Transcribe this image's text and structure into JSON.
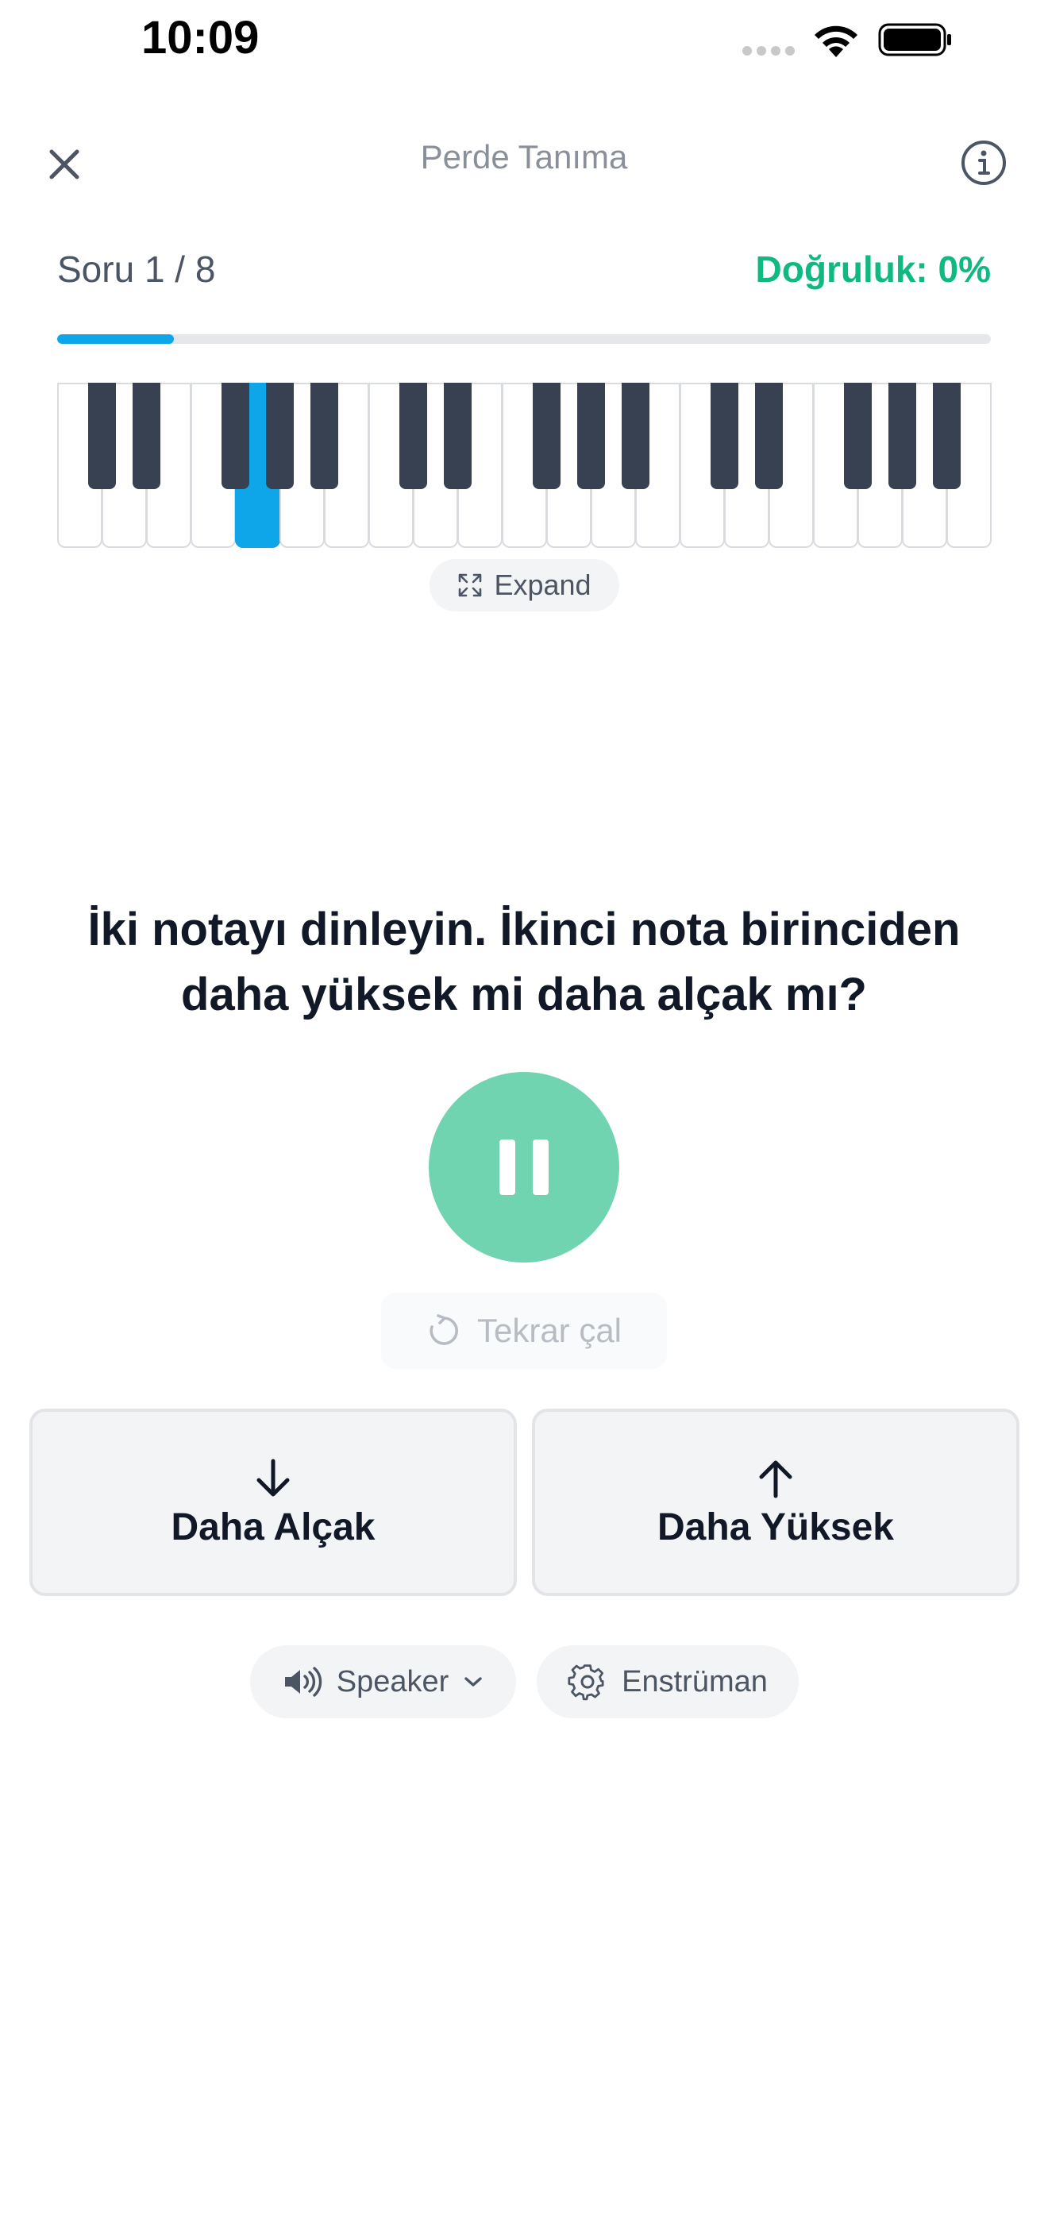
{
  "status_bar": {
    "time": "10:09"
  },
  "header": {
    "title": "Perde Tanıma"
  },
  "progress": {
    "counter": "Soru 1 / 8",
    "accuracy": "Doğruluk: 0%",
    "fraction": 0.125
  },
  "piano": {
    "white_key_count": 21,
    "active_key": "white-4"
  },
  "expand": {
    "label": "Expand"
  },
  "question": {
    "text": "İki notayı dinleyin. İkinci nota birinciden daha yüksek mi daha alçak mı?"
  },
  "replay": {
    "label": "Tekrar çal"
  },
  "answers": {
    "lower": "Daha Alçak",
    "higher": "Daha Yüksek"
  },
  "controls": {
    "output_label": "Speaker",
    "instrument_label": "Enstrüman"
  },
  "colors": {
    "accent_blue": "#0ea5e9",
    "accuracy_green": "#10b981",
    "play_green": "#71d4b1"
  }
}
